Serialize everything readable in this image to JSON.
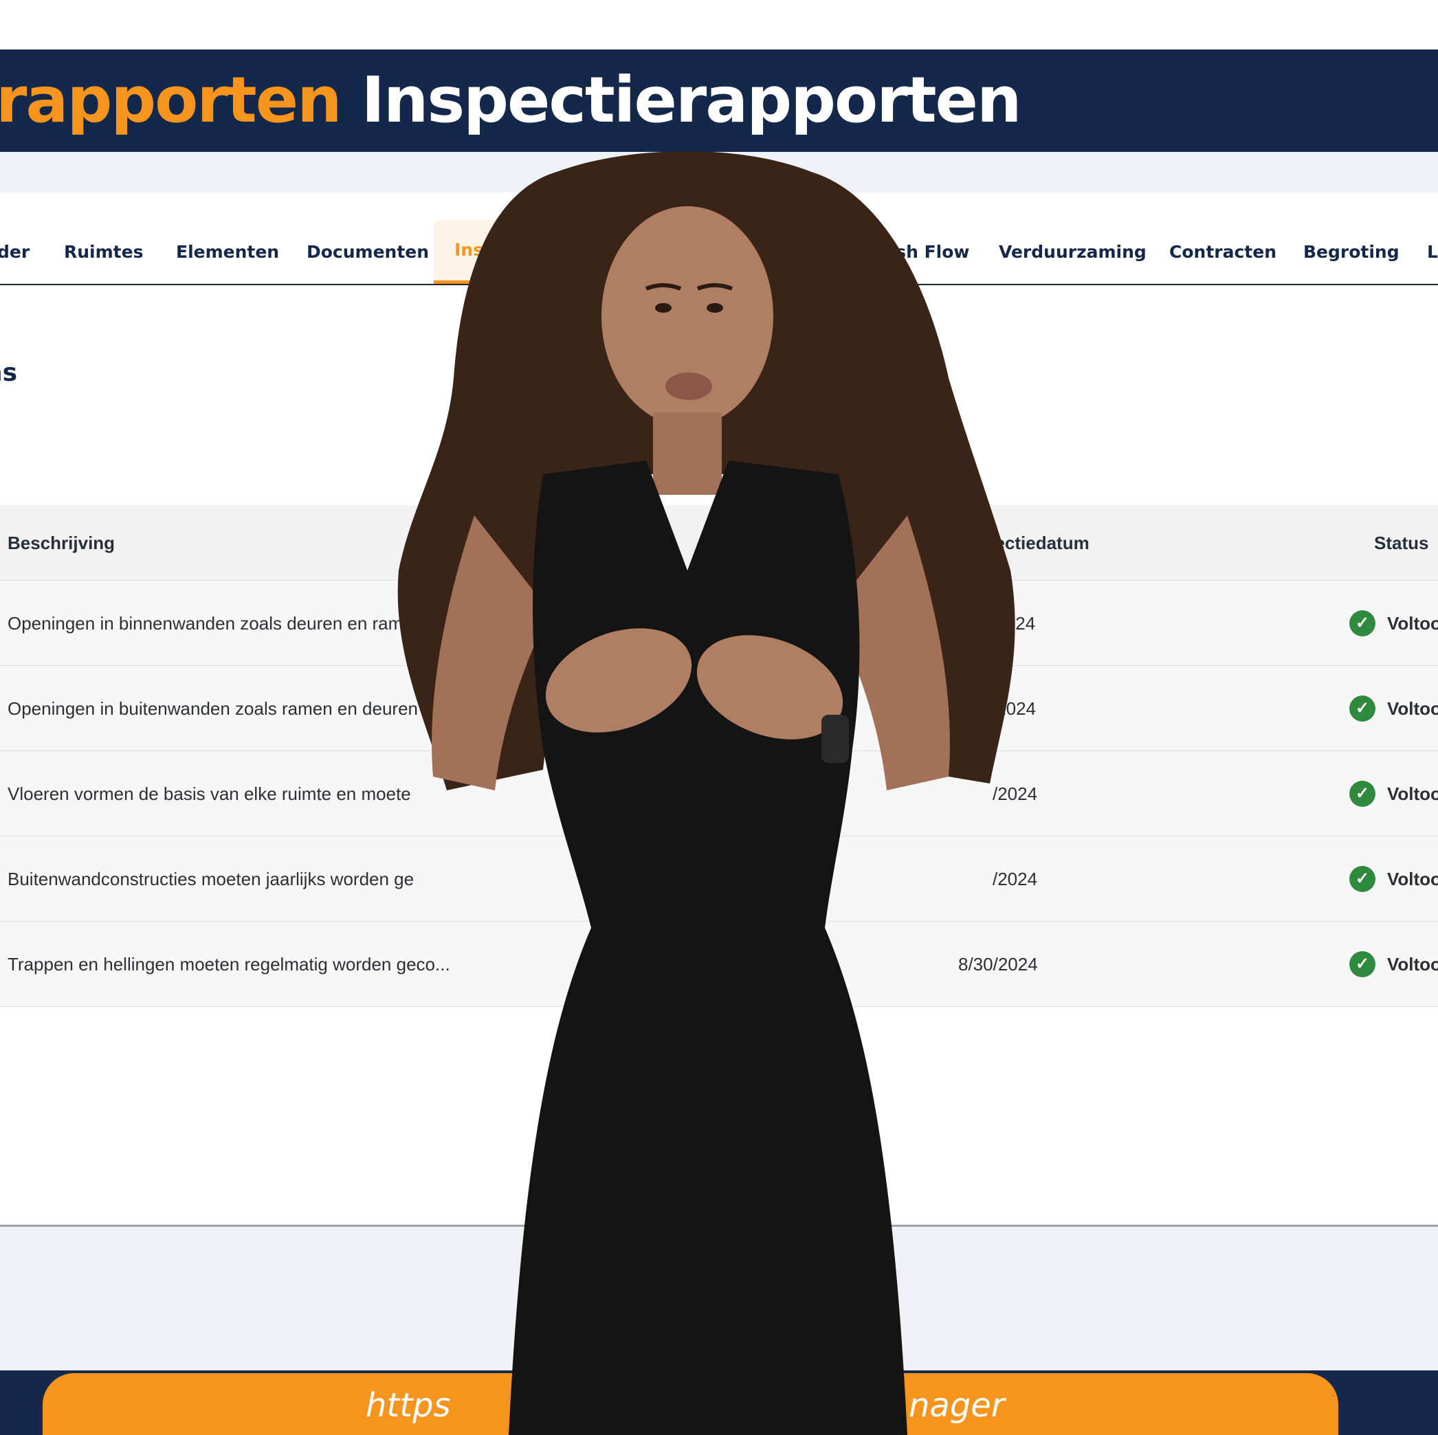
{
  "banner": {
    "title_orange": "rapporten",
    "title_white": "Inspectierapporten"
  },
  "tabs": [
    {
      "label": "der",
      "active": false
    },
    {
      "label": "Ruimtes",
      "active": false
    },
    {
      "label": "Elementen",
      "active": false
    },
    {
      "label": "Documenten",
      "active": false
    },
    {
      "label": "Inspectiera",
      "active": true
    },
    {
      "label": "Cash Flow",
      "active": false
    },
    {
      "label": "Verduurzaming",
      "active": false
    },
    {
      "label": "Contracten",
      "active": false
    },
    {
      "label": "Begroting",
      "active": false
    },
    {
      "label": "L",
      "active": false
    }
  ],
  "section": {
    "heading": "ns"
  },
  "table": {
    "columns": {
      "description": "Beschrijving",
      "date": "Inspectiedatum",
      "status": "Status"
    },
    "rows": [
      {
        "description": "Openingen in binnenwanden zoals deuren en ramen mo",
        "date": "/14/2024",
        "status": "Voltoo"
      },
      {
        "description": "Openingen in buitenwanden zoals ramen en deuren r",
        "date": "14/2024",
        "status": "Voltoo"
      },
      {
        "description": "Vloeren vormen de basis van elke ruimte en moete",
        "date": "/2024",
        "status": "Voltoo"
      },
      {
        "description": "Buitenwandconstructies moeten jaarlijks worden ge",
        "date": "/2024",
        "status": "Voltoo"
      },
      {
        "description": "Trappen en hellingen moeten regelmatig worden geco...",
        "date": "8/30/2024",
        "status": "Voltoo"
      }
    ]
  },
  "footer": {
    "url_left": "https",
    "url_right": "nager"
  },
  "colors": {
    "navy": "#14284b",
    "orange": "#f7941d",
    "success": "#2f8a3e"
  },
  "icons": {
    "status": "check-circle-icon"
  }
}
